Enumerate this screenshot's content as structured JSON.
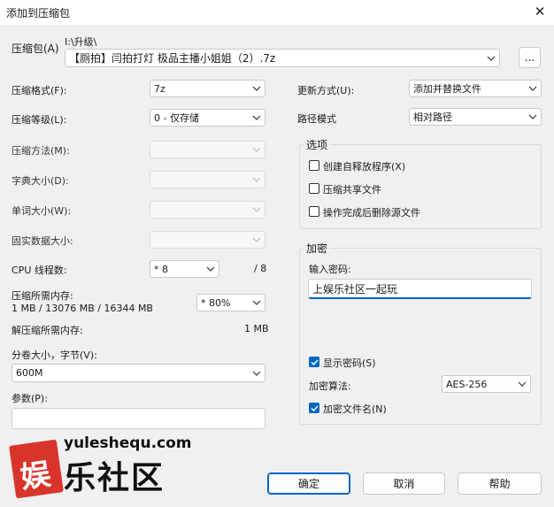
{
  "window": {
    "title": "添加到压缩包"
  },
  "archive": {
    "label": "压缩包(A)",
    "path": "I:\\升级\\",
    "name": "【厕拍】闫拍打灯 极品主播小姐姐（2）.7z",
    "browse_label": "..."
  },
  "left": {
    "format": {
      "label": "压缩格式(F):",
      "value": "7z"
    },
    "level": {
      "label": "压缩等级(L):",
      "value": "0 - 仅存储"
    },
    "method": {
      "label": "压缩方法(M):",
      "value": ""
    },
    "dict": {
      "label": "字典大小(D):",
      "value": ""
    },
    "word": {
      "label": "单词大小(W):",
      "value": ""
    },
    "solid": {
      "label": "固实数据大小:",
      "value": ""
    },
    "threads": {
      "label": "CPU 线程数:",
      "value": "* 8",
      "max": "/ 8"
    },
    "mem": {
      "label": "压缩所需内存:",
      "detail": "1 MB / 13076 MB / 16344 MB",
      "value": "* 80%"
    },
    "decomp": {
      "label": "解压缩所需内存:",
      "value": "1 MB"
    },
    "split": {
      "label": "分卷大小，字节(V):",
      "value": "600M"
    },
    "params": {
      "label": "参数(P):",
      "value": ""
    }
  },
  "right": {
    "update": {
      "label": "更新方式(U):",
      "value": "添加并替换文件"
    },
    "pathmode": {
      "label": "路径模式",
      "value": "相对路径"
    },
    "options": {
      "title": "选项",
      "items": [
        {
          "label": "创建自释放程序(X)",
          "checked": false
        },
        {
          "label": "压缩共享文件",
          "checked": false
        },
        {
          "label": "操作完成后删除源文件",
          "checked": false
        }
      ]
    },
    "encryption": {
      "title": "加密",
      "pwd_label": "输入密码:",
      "pwd_value": "上娱乐社区一起玩",
      "show_pwd": {
        "label": "显示密码(S)",
        "checked": true
      },
      "algo_label": "加密算法:",
      "algo_value": "AES-256",
      "enc_names": {
        "label": "加密文件名(N)",
        "checked": true
      }
    }
  },
  "buttons": {
    "ok": "确定",
    "cancel": "取消",
    "help": "帮助"
  },
  "watermark": {
    "domain": "yuleshequ.com",
    "text": "乐社区",
    "glyph": "娱"
  },
  "colors": {
    "accent": "#0067c0",
    "dialog_bg": "#f0f0f0",
    "watermark_red": "#d9342b"
  }
}
